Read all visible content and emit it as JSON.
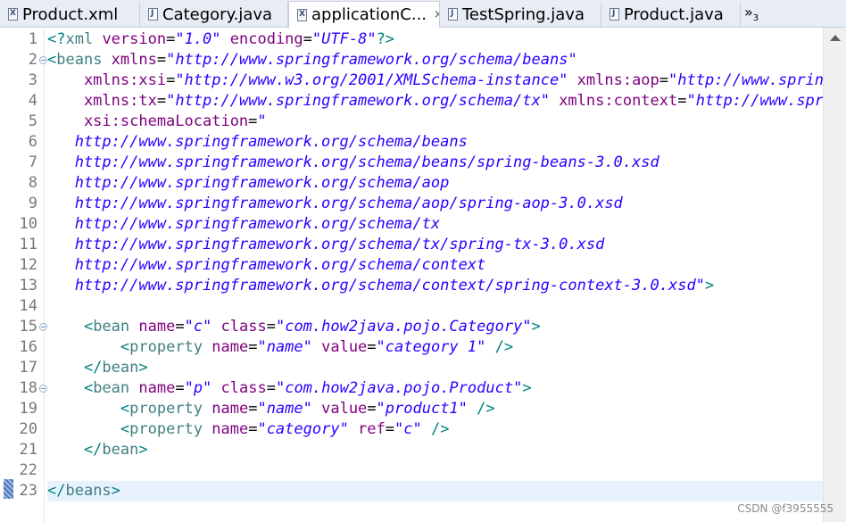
{
  "tabs": [
    {
      "label": "Product.xml",
      "icon": "xml-file-icon",
      "active": false
    },
    {
      "label": "Category.java",
      "icon": "java-file-icon",
      "active": false
    },
    {
      "label": "applicationC...",
      "icon": "xml-file-icon",
      "active": true,
      "close": "×"
    },
    {
      "label": "TestSpring.java",
      "icon": "java-file-icon",
      "active": false
    },
    {
      "label": "Product.java",
      "icon": "java-file-icon",
      "active": false
    }
  ],
  "overflow": {
    "glyph": "»",
    "count": "3"
  },
  "editor": {
    "line_numbers": [
      "1",
      "2",
      "3",
      "4",
      "5",
      "6",
      "7",
      "8",
      "9",
      "10",
      "11",
      "12",
      "13",
      "14",
      "15",
      "16",
      "17",
      "18",
      "19",
      "20",
      "21",
      "22",
      "23"
    ],
    "fold_lines": [
      2,
      15,
      18
    ],
    "current_line": 23,
    "lines": [
      [
        [
          "b",
          "<?"
        ],
        [
          "t",
          "xml"
        ],
        [
          "a",
          " version"
        ],
        [
          "e",
          "="
        ],
        [
          "v",
          "\"1.0\""
        ],
        [
          "a",
          " encoding"
        ],
        [
          "e",
          "="
        ],
        [
          "v",
          "\"UTF-8\""
        ],
        [
          "b",
          "?>"
        ]
      ],
      [
        [
          "b",
          "<"
        ],
        [
          "t",
          "beans"
        ],
        [
          "a",
          " xmlns"
        ],
        [
          "e",
          "="
        ],
        [
          "v",
          "\"http://www.springframework.org/schema/beans\""
        ]
      ],
      [
        [
          "a",
          "    xmlns:xsi"
        ],
        [
          "e",
          "="
        ],
        [
          "v",
          "\"http://www.w3.org/2001/XMLSchema-instance\""
        ],
        [
          "a",
          " xmlns:aop"
        ],
        [
          "e",
          "="
        ],
        [
          "v",
          "\"http://www.springframework.org/schema/aop\""
        ]
      ],
      [
        [
          "a",
          "    xmlns:tx"
        ],
        [
          "e",
          "="
        ],
        [
          "v",
          "\"http://www.springframework.org/schema/tx\""
        ],
        [
          "a",
          " xmlns:context"
        ],
        [
          "e",
          "="
        ],
        [
          "v",
          "\"http://www.springframework.org/schema/context\""
        ]
      ],
      [
        [
          "a",
          "    xsi:schemaLocation"
        ],
        [
          "e",
          "="
        ],
        [
          "v",
          "\""
        ]
      ],
      [
        [
          "v",
          "   http://www.springframework.org/schema/beans"
        ]
      ],
      [
        [
          "v",
          "   http://www.springframework.org/schema/beans/spring-beans-3.0.xsd"
        ]
      ],
      [
        [
          "v",
          "   http://www.springframework.org/schema/aop"
        ]
      ],
      [
        [
          "v",
          "   http://www.springframework.org/schema/aop/spring-aop-3.0.xsd"
        ]
      ],
      [
        [
          "v",
          "   http://www.springframework.org/schema/tx"
        ]
      ],
      [
        [
          "v",
          "   http://www.springframework.org/schema/tx/spring-tx-3.0.xsd"
        ]
      ],
      [
        [
          "v",
          "   http://www.springframework.org/schema/context"
        ]
      ],
      [
        [
          "v",
          "   http://www.springframework.org/schema/context/spring-context-3.0.xsd\""
        ],
        [
          "b",
          ">"
        ]
      ],
      [],
      [
        [
          "b",
          "    <"
        ],
        [
          "t",
          "bean"
        ],
        [
          "a",
          " name"
        ],
        [
          "e",
          "="
        ],
        [
          "v",
          "\"c\""
        ],
        [
          "a",
          " class"
        ],
        [
          "e",
          "="
        ],
        [
          "v",
          "\"com.how2java.pojo.Category\""
        ],
        [
          "b",
          ">"
        ]
      ],
      [
        [
          "b",
          "        <"
        ],
        [
          "t",
          "property"
        ],
        [
          "a",
          " name"
        ],
        [
          "e",
          "="
        ],
        [
          "v",
          "\"name\""
        ],
        [
          "a",
          " value"
        ],
        [
          "e",
          "="
        ],
        [
          "v",
          "\"category 1\""
        ],
        [
          "b",
          " />"
        ]
      ],
      [
        [
          "b",
          "    </"
        ],
        [
          "t",
          "bean"
        ],
        [
          "b",
          ">"
        ]
      ],
      [
        [
          "b",
          "    <"
        ],
        [
          "t",
          "bean"
        ],
        [
          "a",
          " name"
        ],
        [
          "e",
          "="
        ],
        [
          "v",
          "\"p\""
        ],
        [
          "a",
          " class"
        ],
        [
          "e",
          "="
        ],
        [
          "v",
          "\"com.how2java.pojo.Product\""
        ],
        [
          "b",
          ">"
        ]
      ],
      [
        [
          "b",
          "        <"
        ],
        [
          "t",
          "property"
        ],
        [
          "a",
          " name"
        ],
        [
          "e",
          "="
        ],
        [
          "v",
          "\"name\""
        ],
        [
          "a",
          " value"
        ],
        [
          "e",
          "="
        ],
        [
          "v",
          "\"product1\""
        ],
        [
          "b",
          " />"
        ]
      ],
      [
        [
          "b",
          "        <"
        ],
        [
          "t",
          "property"
        ],
        [
          "a",
          " name"
        ],
        [
          "e",
          "="
        ],
        [
          "v",
          "\"category\""
        ],
        [
          "a",
          " ref"
        ],
        [
          "e",
          "="
        ],
        [
          "v",
          "\"c\""
        ],
        [
          "b",
          " />"
        ]
      ],
      [
        [
          "b",
          "    </"
        ],
        [
          "t",
          "bean"
        ],
        [
          "b",
          ">"
        ]
      ],
      [],
      [
        [
          "b",
          "</"
        ],
        [
          "t",
          "beans"
        ],
        [
          "b",
          ">"
        ]
      ]
    ]
  },
  "watermark": "CSDN @f3955555",
  "colors": {
    "bracket": "#008080",
    "tag": "#3f7f7f",
    "attribute": "#7f007f",
    "value": "#2a00ff",
    "current_line_bg": "#e8f2fe"
  }
}
